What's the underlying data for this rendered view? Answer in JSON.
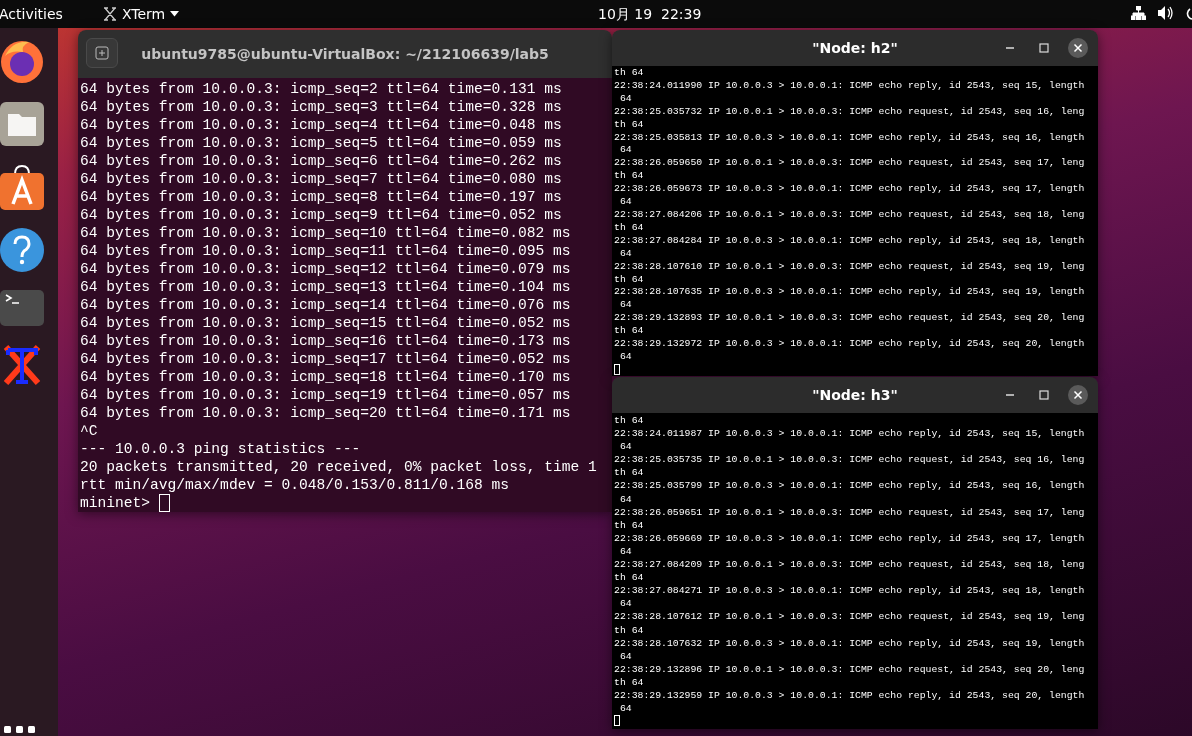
{
  "top_bar": {
    "activities": "Activities",
    "app_menu": "XTerm",
    "clock": "10月 19  22:39"
  },
  "dock": {
    "apps": [
      {
        "kind": "firefox"
      },
      {
        "kind": "files"
      },
      {
        "kind": "store"
      },
      {
        "kind": "help"
      },
      {
        "kind": "terminal"
      },
      {
        "kind": "xterm"
      }
    ]
  },
  "terminal": {
    "title": "ubuntu9785@ubuntu-VirtualBox: ~/212106639/lab5",
    "prompt": "mininet>",
    "lines": [
      "64 bytes from 10.0.0.3: icmp_seq=2 ttl=64 time=0.131 ms",
      "64 bytes from 10.0.0.3: icmp_seq=3 ttl=64 time=0.328 ms",
      "64 bytes from 10.0.0.3: icmp_seq=4 ttl=64 time=0.048 ms",
      "64 bytes from 10.0.0.3: icmp_seq=5 ttl=64 time=0.059 ms",
      "64 bytes from 10.0.0.3: icmp_seq=6 ttl=64 time=0.262 ms",
      "64 bytes from 10.0.0.3: icmp_seq=7 ttl=64 time=0.080 ms",
      "64 bytes from 10.0.0.3: icmp_seq=8 ttl=64 time=0.197 ms",
      "64 bytes from 10.0.0.3: icmp_seq=9 ttl=64 time=0.052 ms",
      "64 bytes from 10.0.0.3: icmp_seq=10 ttl=64 time=0.082 ms",
      "64 bytes from 10.0.0.3: icmp_seq=11 ttl=64 time=0.095 ms",
      "64 bytes from 10.0.0.3: icmp_seq=12 ttl=64 time=0.079 ms",
      "64 bytes from 10.0.0.3: icmp_seq=13 ttl=64 time=0.104 ms",
      "64 bytes from 10.0.0.3: icmp_seq=14 ttl=64 time=0.076 ms",
      "64 bytes from 10.0.0.3: icmp_seq=15 ttl=64 time=0.052 ms",
      "64 bytes from 10.0.0.3: icmp_seq=16 ttl=64 time=0.173 ms",
      "64 bytes from 10.0.0.3: icmp_seq=17 ttl=64 time=0.052 ms",
      "64 bytes from 10.0.0.3: icmp_seq=18 ttl=64 time=0.170 ms",
      "64 bytes from 10.0.0.3: icmp_seq=19 ttl=64 time=0.057 ms",
      "64 bytes from 10.0.0.3: icmp_seq=20 ttl=64 time=0.171 ms",
      "^C",
      "--- 10.0.0.3 ping statistics ---",
      "20 packets transmitted, 20 received, 0% packet loss, time 1",
      "rtt min/avg/max/mdev = 0.048/0.153/0.811/0.168 ms"
    ]
  },
  "xterms": [
    {
      "title": "\"Node: h2\"",
      "lines": [
        "th 64",
        "22:38:24.011990 IP 10.0.0.3 > 10.0.0.1: ICMP echo reply, id 2543, seq 15, length",
        " 64",
        "22:38:25.035732 IP 10.0.0.1 > 10.0.0.3: ICMP echo request, id 2543, seq 16, leng",
        "th 64",
        "22:38:25.035813 IP 10.0.0.3 > 10.0.0.1: ICMP echo reply, id 2543, seq 16, length",
        " 64",
        "22:38:26.059650 IP 10.0.0.1 > 10.0.0.3: ICMP echo request, id 2543, seq 17, leng",
        "th 64",
        "22:38:26.059673 IP 10.0.0.3 > 10.0.0.1: ICMP echo reply, id 2543, seq 17, length",
        " 64",
        "22:38:27.084206 IP 10.0.0.1 > 10.0.0.3: ICMP echo request, id 2543, seq 18, leng",
        "th 64",
        "22:38:27.084284 IP 10.0.0.3 > 10.0.0.1: ICMP echo reply, id 2543, seq 18, length",
        " 64",
        "22:38:28.107610 IP 10.0.0.1 > 10.0.0.3: ICMP echo request, id 2543, seq 19, leng",
        "th 64",
        "22:38:28.107635 IP 10.0.0.3 > 10.0.0.1: ICMP echo reply, id 2543, seq 19, length",
        " 64",
        "22:38:29.132893 IP 10.0.0.1 > 10.0.0.3: ICMP echo request, id 2543, seq 20, leng",
        "th 64",
        "22:38:29.132972 IP 10.0.0.3 > 10.0.0.1: ICMP echo reply, id 2543, seq 20, length",
        " 64"
      ]
    },
    {
      "title": "\"Node: h3\"",
      "lines": [
        "th 64",
        "22:38:24.011987 IP 10.0.0.3 > 10.0.0.1: ICMP echo reply, id 2543, seq 15, length",
        " 64",
        "22:38:25.035735 IP 10.0.0.1 > 10.0.0.3: ICMP echo request, id 2543, seq 16, leng",
        "th 64",
        "22:38:25.035799 IP 10.0.0.3 > 10.0.0.1: ICMP echo reply, id 2543, seq 16, length",
        " 64",
        "22:38:26.059651 IP 10.0.0.1 > 10.0.0.3: ICMP echo request, id 2543, seq 17, leng",
        "th 64",
        "22:38:26.059669 IP 10.0.0.3 > 10.0.0.1: ICMP echo reply, id 2543, seq 17, length",
        " 64",
        "22:38:27.084209 IP 10.0.0.1 > 10.0.0.3: ICMP echo request, id 2543, seq 18, leng",
        "th 64",
        "22:38:27.084271 IP 10.0.0.3 > 10.0.0.1: ICMP echo reply, id 2543, seq 18, length",
        " 64",
        "22:38:28.107612 IP 10.0.0.1 > 10.0.0.3: ICMP echo request, id 2543, seq 19, leng",
        "th 64",
        "22:38:28.107632 IP 10.0.0.3 > 10.0.0.1: ICMP echo reply, id 2543, seq 19, length",
        " 64",
        "22:38:29.132896 IP 10.0.0.1 > 10.0.0.3: ICMP echo request, id 2543, seq 20, leng",
        "th 64",
        "22:38:29.132959 IP 10.0.0.3 > 10.0.0.1: ICMP echo reply, id 2543, seq 20, length",
        " 64"
      ]
    }
  ]
}
